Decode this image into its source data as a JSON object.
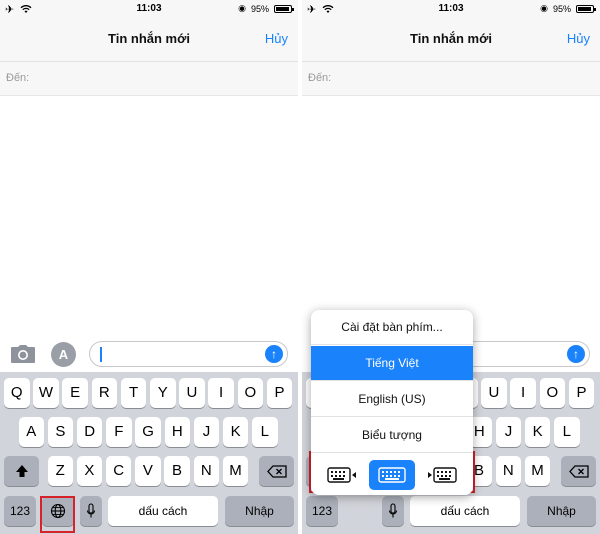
{
  "status_bar": {
    "time": "11:03",
    "battery": "95%",
    "battery_level": 0.95
  },
  "nav": {
    "title": "Tin nhắn mới",
    "cancel": "Hủy"
  },
  "to_field": {
    "label": "Đến:"
  },
  "keyboard": {
    "row1": [
      "Q",
      "W",
      "E",
      "R",
      "T",
      "Y",
      "U",
      "I",
      "O",
      "P"
    ],
    "row2": [
      "A",
      "S",
      "D",
      "F",
      "G",
      "H",
      "J",
      "K",
      "L"
    ],
    "row3": [
      "Z",
      "X",
      "C",
      "V",
      "B",
      "N",
      "M"
    ],
    "numbers_key": "123",
    "space_key": "dấu cách",
    "return_key": "Nhập"
  },
  "popup": {
    "items": [
      "Cài đặt bàn phím...",
      "Tiếng Việt",
      "English (US)",
      "Biểu tượng"
    ],
    "selected_index": 1
  },
  "colors": {
    "accent": "#1a82fb",
    "highlight": "#d6222a",
    "keyboard_bg": "#d1d4da"
  }
}
